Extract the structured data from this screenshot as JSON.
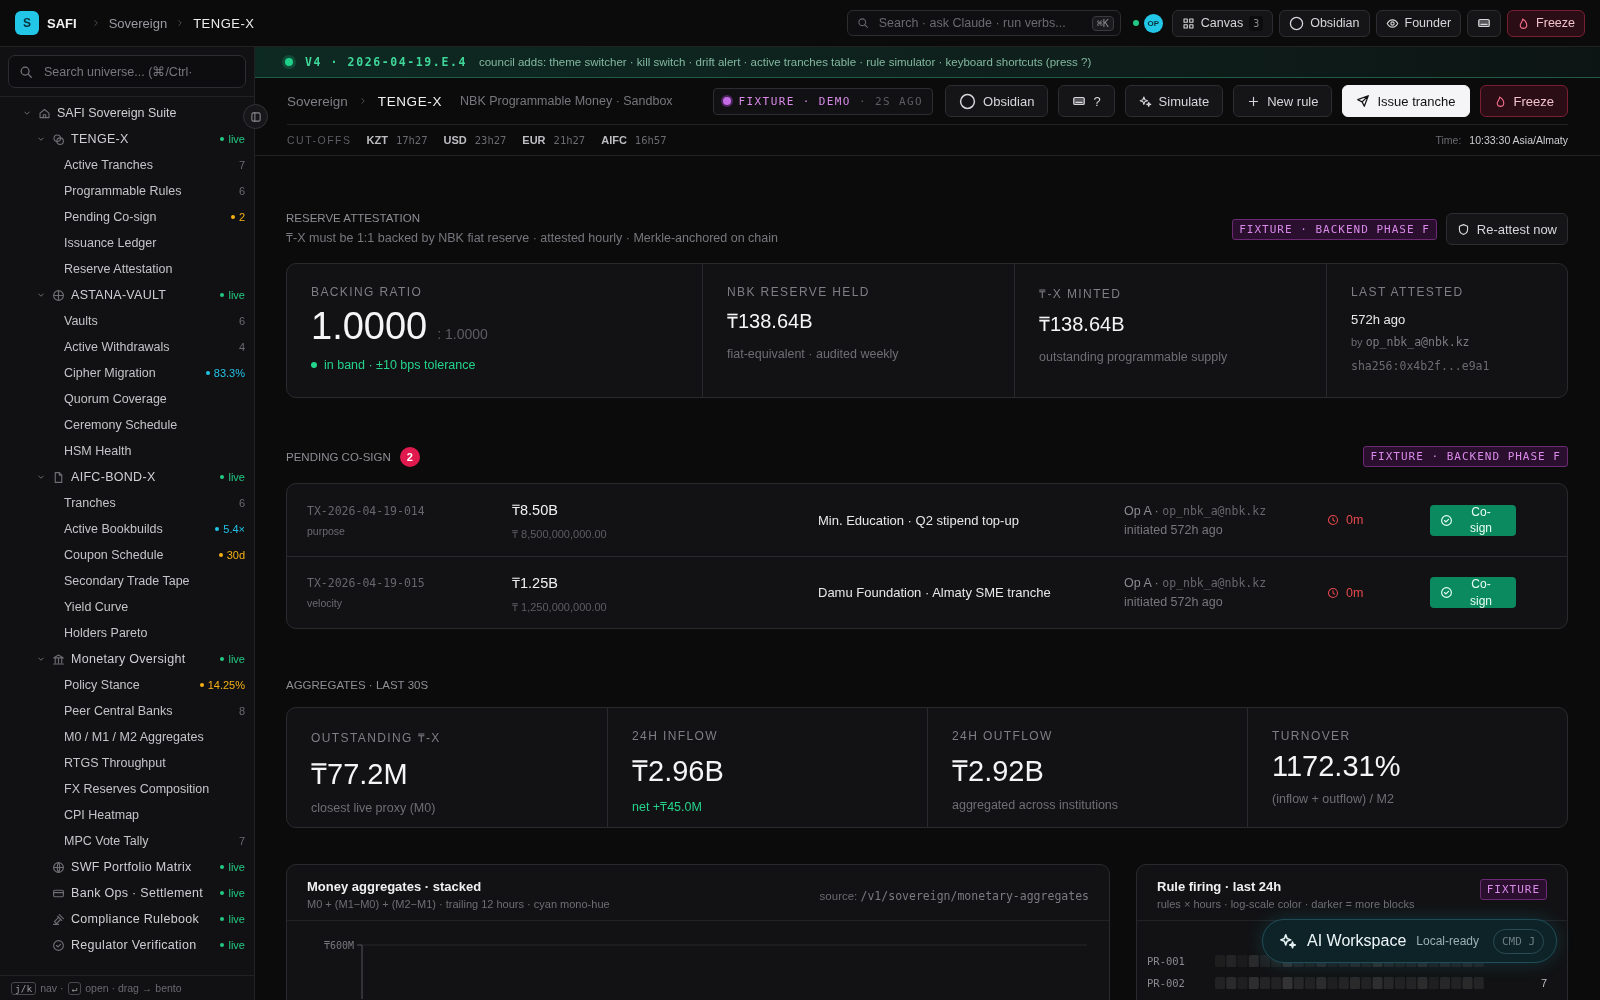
{
  "topbar": {
    "logo": "S",
    "brand": "SAFI",
    "breadcrumb": [
      "Sovereign",
      "TENGE-X"
    ],
    "search": {
      "placeholder": "Search · ask Claude · run verbs...",
      "shortcut": "⌘K"
    },
    "avatar": "OP",
    "buttons": [
      {
        "kind": "canvas",
        "label": "Canvas",
        "count": "3"
      },
      {
        "kind": "theme",
        "label": "Obsidian"
      },
      {
        "kind": "view",
        "label": "Founder"
      },
      {
        "kind": "keyboard"
      },
      {
        "kind": "danger",
        "label": "Freeze"
      }
    ]
  },
  "sidebar": {
    "search": {
      "placeholder": "Search universe... (⌘/Ctrl·"
    },
    "tree": [
      {
        "label": "SAFI Sovereign Suite",
        "expanded": true,
        "children": [
          {
            "label": "TENGE-X",
            "badge": "live",
            "color": "#22c983",
            "expanded": true,
            "children": [
              {
                "label": "Active Tranches",
                "badge": "7"
              },
              {
                "label": "Programmable Rules",
                "badge": "6"
              },
              {
                "label": "Pending Co-sign",
                "badge": "2",
                "color": "#f5b014"
              },
              {
                "label": "Issuance Ledger"
              },
              {
                "label": "Reserve Attestation"
              }
            ]
          },
          {
            "label": "ASTANA-VAULT",
            "badge": "live",
            "color": "#22c983",
            "expanded": true,
            "children": [
              {
                "label": "Vaults",
                "badge": "6"
              },
              {
                "label": "Active Withdrawals",
                "badge": "4"
              },
              {
                "label": "Cipher Migration",
                "badge": "83.3%",
                "color": "#22c3e6"
              },
              {
                "label": "Quorum Coverage"
              },
              {
                "label": "Ceremony Schedule"
              },
              {
                "label": "HSM Health"
              }
            ]
          },
          {
            "label": "AIFC-BOND-X",
            "badge": "live",
            "color": "#22c983",
            "expanded": true,
            "children": [
              {
                "label": "Tranches",
                "badge": "6"
              },
              {
                "label": "Active Bookbuilds",
                "badge": "5.4×",
                "color": "#22c3e6"
              },
              {
                "label": "Coupon Schedule",
                "badge": "30d",
                "color": "#f5b014"
              },
              {
                "label": "Secondary Trade Tape"
              },
              {
                "label": "Yield Curve"
              },
              {
                "label": "Holders Pareto"
              }
            ]
          },
          {
            "label": "Monetary Oversight",
            "badge": "live",
            "color": "#22c983",
            "expanded": true,
            "children": [
              {
                "label": "Policy Stance",
                "badge": "14.25%",
                "color": "#f5b014"
              },
              {
                "label": "Peer Central Banks",
                "badge": "8"
              },
              {
                "label": "M0 / M1 / M2 Aggregates"
              },
              {
                "label": "RTGS Throughput"
              },
              {
                "label": "FX Reserves Composition"
              },
              {
                "label": "CPI Heatmap"
              },
              {
                "label": "MPC Vote Tally",
                "badge": "7"
              }
            ]
          },
          {
            "label": "SWF Portfolio Matrix",
            "badge": "live",
            "color": "#22c983"
          },
          {
            "label": "Bank Ops · Settlement",
            "badge": "live",
            "color": "#22c983"
          },
          {
            "label": "Compliance Rulebook",
            "badge": "live",
            "color": "#22c983"
          },
          {
            "label": "Regulator Verification",
            "badge": "live",
            "color": "#22c983"
          }
        ]
      }
    ],
    "footer": [
      {
        "kind": "key",
        "text": "j/k"
      },
      {
        "kind": "text",
        "text": "nav ·"
      },
      {
        "kind": "key",
        "text": "↵"
      },
      {
        "kind": "text",
        "text": "open · drag → bento"
      }
    ]
  },
  "banner": {
    "version": "V4 · 2026-04-19.E.4",
    "text": "council adds: theme switcher · kill switch · drift alert · active tranches table · rule simulator · keyboard shortcuts (press ?)"
  },
  "header": {
    "breadcrumb": [
      "Sovereign",
      "TENGE-X"
    ],
    "subtitle": "NBK Programmable Money · Sandbox",
    "fixture": {
      "label": "FIXTURE · DEMO",
      "age": "· 2S AGO"
    },
    "buttons": [
      {
        "kind": "theme",
        "label": "Obsidian"
      },
      {
        "kind": "keyboard",
        "label": "?"
      },
      {
        "kind": "simulate",
        "label": "Simulate"
      },
      {
        "kind": "add",
        "label": "New rule"
      },
      {
        "kind": "primary",
        "label": "Issue tranche"
      },
      {
        "kind": "danger",
        "label": "Freeze"
      }
    ],
    "cutoffs_label": "CUT-OFFS",
    "cutoffs": [
      {
        "currency": "KZT",
        "time": "17h27"
      },
      {
        "currency": "USD",
        "time": "23h27"
      },
      {
        "currency": "EUR",
        "time": "21h27"
      },
      {
        "currency": "AIFC",
        "time": "16h57"
      }
    ],
    "time_label": "Time:",
    "time": "10:33:30 Asia/Almaty"
  },
  "reserve": {
    "title": "RESERVE ATTESTATION",
    "description": "₸-X must be 1:1 backed by NBK fiat reserve · attested hourly · Merkle-anchored on chain",
    "tag": "FIXTURE · BACKEND PHASE F",
    "button": "Re-attest now",
    "cards": [
      {
        "kind": "ratio",
        "label": "BACKING RATIO",
        "value": "1.0000",
        "suffix": ": 1.0000",
        "note": "in band · ±10 bps tolerance"
      },
      {
        "kind": "amount",
        "label": "NBK RESERVE HELD",
        "value": "₸138.64B",
        "note": "fiat-equivalent · audited weekly"
      },
      {
        "kind": "amount",
        "label": "₸-X MINTED",
        "value": "₸138.64B",
        "note": "outstanding programmable supply"
      },
      {
        "kind": "attest",
        "label": "LAST ATTESTED",
        "value": "572h ago",
        "by": "by",
        "user": "op_nbk_a@nbk.kz",
        "hash": "sha256:0x4b2f...e9a1"
      }
    ]
  },
  "pending": {
    "title": "PENDING CO-SIGN",
    "count": "2",
    "tag": "FIXTURE · BACKEND PHASE F",
    "rows": [
      {
        "id": "TX-2026-04-19-014",
        "rule": "purpose",
        "amount": "₸8.50B",
        "amount_full": "₸ 8,500,000,000.00",
        "description": "Min. Education · Q2 stipend top-up",
        "operator": "Op A ·",
        "email": "op_nbk_a@nbk.kz",
        "initiated": "initiated 572h ago",
        "timer": "0m",
        "button": "Co-sign"
      },
      {
        "id": "TX-2026-04-19-015",
        "rule": "velocity",
        "amount": "₸1.25B",
        "amount_full": "₸ 1,250,000,000.00",
        "description": "Damu Foundation · Almaty SME tranche",
        "operator": "Op A ·",
        "email": "op_nbk_a@nbk.kz",
        "initiated": "initiated 572h ago",
        "timer": "0m",
        "button": "Co-sign"
      }
    ]
  },
  "aggregates": {
    "title": "AGGREGATES · LAST 30S",
    "cards": [
      {
        "label": "OUTSTANDING ₸-X",
        "value": "₸77.2M",
        "note": "closest live proxy (M0)",
        "positive": false
      },
      {
        "label": "24H INFLOW",
        "value": "₸2.96B",
        "note": "net +₸45.0M",
        "positive": true
      },
      {
        "label": "24H OUTFLOW",
        "value": "₸2.92B",
        "note": "aggregated across institutions",
        "positive": false
      },
      {
        "label": "TURNOVER",
        "value": "1172.31%",
        "note": "(inflow + outflow) / M2",
        "positive": false
      }
    ]
  },
  "money_chart": {
    "title": "Money aggregates · stacked",
    "subtitle": "M0 + (M1−M0) + (M2−M1) · trailing 12 hours · cyan mono-hue",
    "source_label": "source:",
    "source": "/v1/sovereign/monetary-aggregates",
    "tick": "₸600M"
  },
  "rule_firing": {
    "title": "Rule firing · last 24h",
    "subtitle": "rules × hours · log-scale color · darker = more blocks",
    "tag": "FIXTURE",
    "rows": [
      {
        "rule": "PR-001"
      },
      {
        "rule": "PR-002",
        "total": "7"
      }
    ]
  },
  "ai_workspace": {
    "title": "AI Workspace",
    "status": "Local-ready",
    "shortcut": "CMD J"
  }
}
